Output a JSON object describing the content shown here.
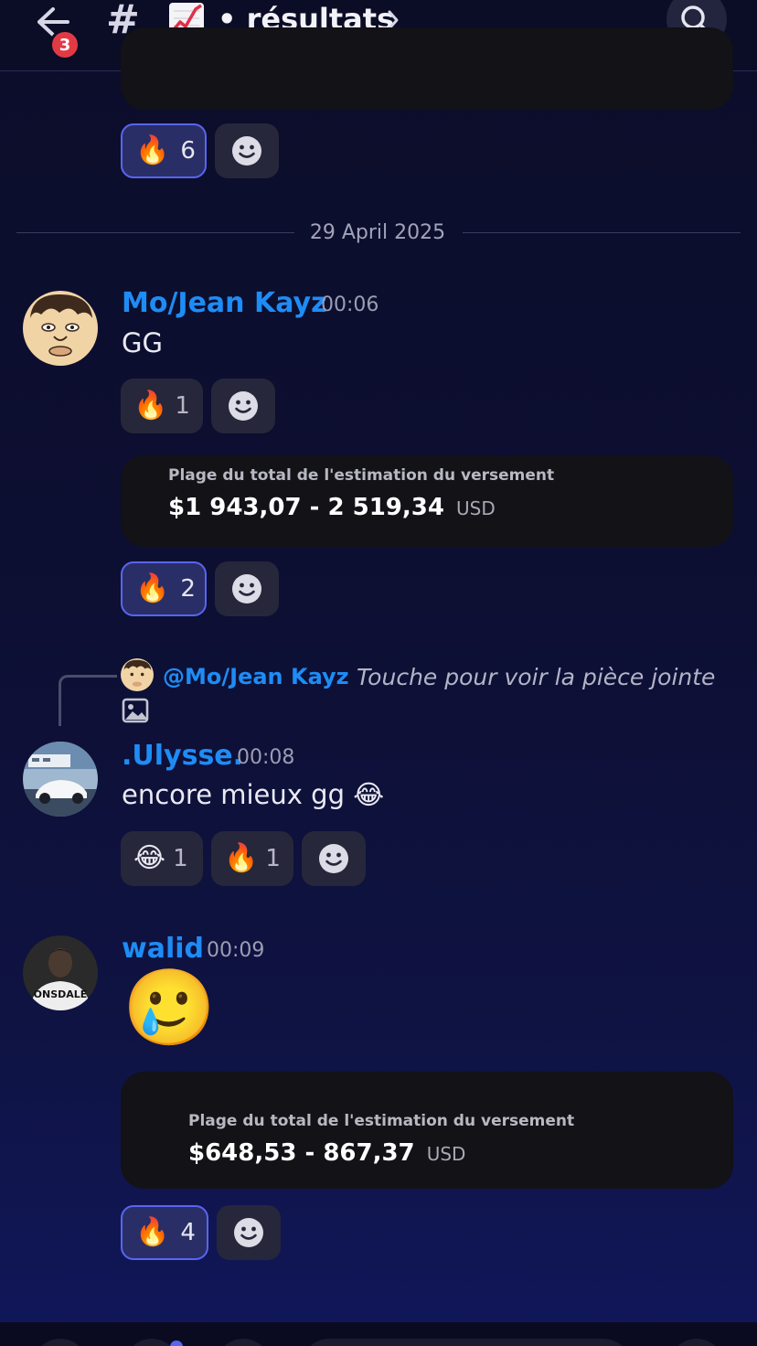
{
  "header": {
    "back_badge": "3",
    "hash": "#",
    "channel_emoji": "📈",
    "channel_name": "• résultats"
  },
  "top_reactions": [
    {
      "emoji": "🔥",
      "count": "6"
    }
  ],
  "date_divider": "29 April 2025",
  "messages": [
    {
      "author": "Mo/Jean Kayz",
      "time": "00:06",
      "text": "GG",
      "reactions": [
        {
          "emoji": "🔥",
          "count": "1"
        }
      ],
      "embed": {
        "title": "Plage du total de l'estimation du versement",
        "value": "$1 943,07 - 2 519,34",
        "currency": "USD"
      },
      "embed_reactions": [
        {
          "emoji": "🔥",
          "count": "2"
        }
      ]
    },
    {
      "reply_to": {
        "name": "@Mo/Jean Kayz",
        "text": "Touche pour voir la pièce jointe"
      },
      "author": ".Ulysse.",
      "time": "00:08",
      "text": "encore mieux gg 😂",
      "reactions": [
        {
          "emoji": "😂",
          "count": "1"
        },
        {
          "emoji": "🔥",
          "count": "1"
        }
      ]
    },
    {
      "author": "walid",
      "time": "00:09",
      "text": "🥲",
      "embed": {
        "title": "Plage du total de l'estimation du versement",
        "value": "$648,53 - 867,37",
        "currency": "USD"
      },
      "embed_reactions": [
        {
          "emoji": "🔥",
          "count": "4"
        }
      ]
    }
  ],
  "icons": [
    "back-arrow-icon",
    "hash-icon",
    "chart-icon",
    "chevron-right-icon",
    "search-icon",
    "add-reaction-icon",
    "image-icon"
  ],
  "colors": {
    "accent": "#5865f2",
    "username": "#1e8cf5",
    "badge": "#e23a45"
  }
}
